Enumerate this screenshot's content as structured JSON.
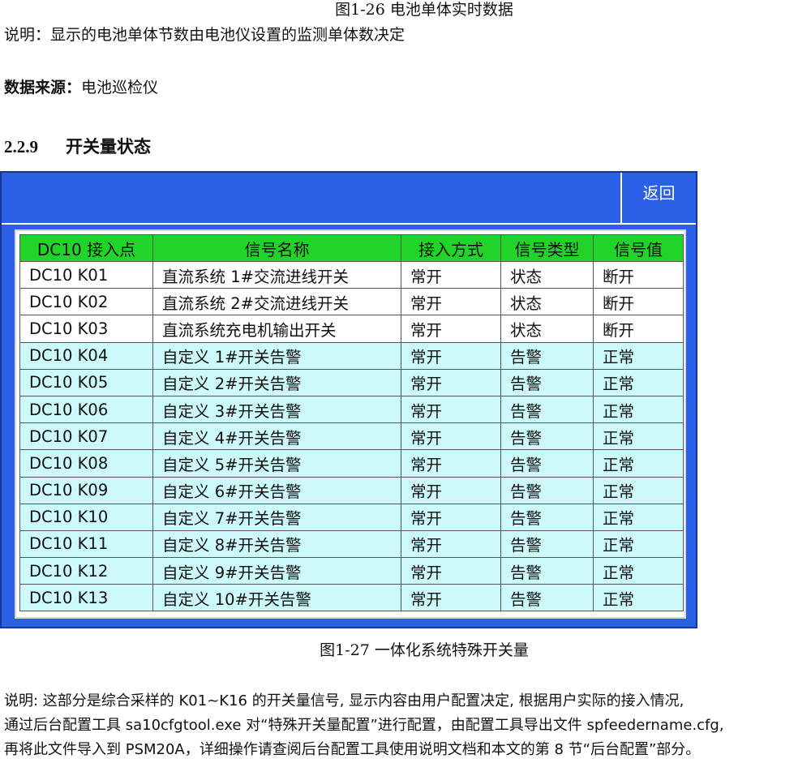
{
  "caption_top": "图1-26 电池单体实时数据",
  "note_top": "说明：显示的电池单体节数由电池仪设置的监测单体数决定",
  "source": {
    "label": "数据来源：",
    "value": "电池巡检仪"
  },
  "section": {
    "number": "2.2.9",
    "title": "开关量状态"
  },
  "panel": {
    "back_label": "返回",
    "accent_color": "#2b5fe6",
    "header_color": "#22d42a",
    "alt_row_color": "#ccfafa"
  },
  "table": {
    "columns": [
      "DC10 接入点",
      "信号名称",
      "接入方式",
      "信号类型",
      "信号值"
    ],
    "rows": [
      {
        "c": [
          "DC10 K01",
          "直流系统 1#交流进线开关",
          "常开",
          "状态",
          "断开"
        ],
        "style": "white"
      },
      {
        "c": [
          "DC10 K02",
          "直流系统 2#交流进线开关",
          "常开",
          "状态",
          "断开"
        ],
        "style": "white"
      },
      {
        "c": [
          "DC10 K03",
          "直流系统充电机输出开关",
          "常开",
          "状态",
          "断开"
        ],
        "style": "white"
      },
      {
        "c": [
          "DC10 K04",
          "自定义 1#开关告警",
          "常开",
          "告警",
          "正常"
        ],
        "style": "cyan"
      },
      {
        "c": [
          "DC10 K05",
          "自定义 2#开关告警",
          "常开",
          "告警",
          "正常"
        ],
        "style": "cyan"
      },
      {
        "c": [
          "DC10 K06",
          "自定义 3#开关告警",
          "常开",
          "告警",
          "正常"
        ],
        "style": "cyan"
      },
      {
        "c": [
          "DC10 K07",
          "自定义 4#开关告警",
          "常开",
          "告警",
          "正常"
        ],
        "style": "cyan"
      },
      {
        "c": [
          "DC10 K08",
          "自定义 5#开关告警",
          "常开",
          "告警",
          "正常"
        ],
        "style": "cyan"
      },
      {
        "c": [
          "DC10 K09",
          "自定义 6#开关告警",
          "常开",
          "告警",
          "正常"
        ],
        "style": "cyan"
      },
      {
        "c": [
          "DC10 K10",
          "自定义 7#开关告警",
          "常开",
          "告警",
          "正常"
        ],
        "style": "cyan"
      },
      {
        "c": [
          "DC10 K11",
          "自定义 8#开关告警",
          "常开",
          "告警",
          "正常"
        ],
        "style": "cyan"
      },
      {
        "c": [
          "DC10 K12",
          "自定义 9#开关告警",
          "常开",
          "告警",
          "正常"
        ],
        "style": "cyan"
      },
      {
        "c": [
          "DC10 K13",
          "自定义 10#开关告警",
          "常开",
          "告警",
          "正常"
        ],
        "style": "cyan"
      }
    ]
  },
  "caption_bottom": "图1-27 一体化系统特殊开关量",
  "note_bottom": [
    "说明: 这部分是综合采样的 K01~K16 的开关量信号, 显示内容由用户配置决定, 根据用户实际的接入情况,",
    "通过后台配置工具 sa10cfgtool.exe 对“特殊开关量配置”进行配置，由配置工具导出文件 spfeedername.cfg,",
    "再将此文件导入到 PSM20A，详细操作请查阅后台配置工具使用说明文档和本文的第 8 节“后台配置”部分。"
  ]
}
